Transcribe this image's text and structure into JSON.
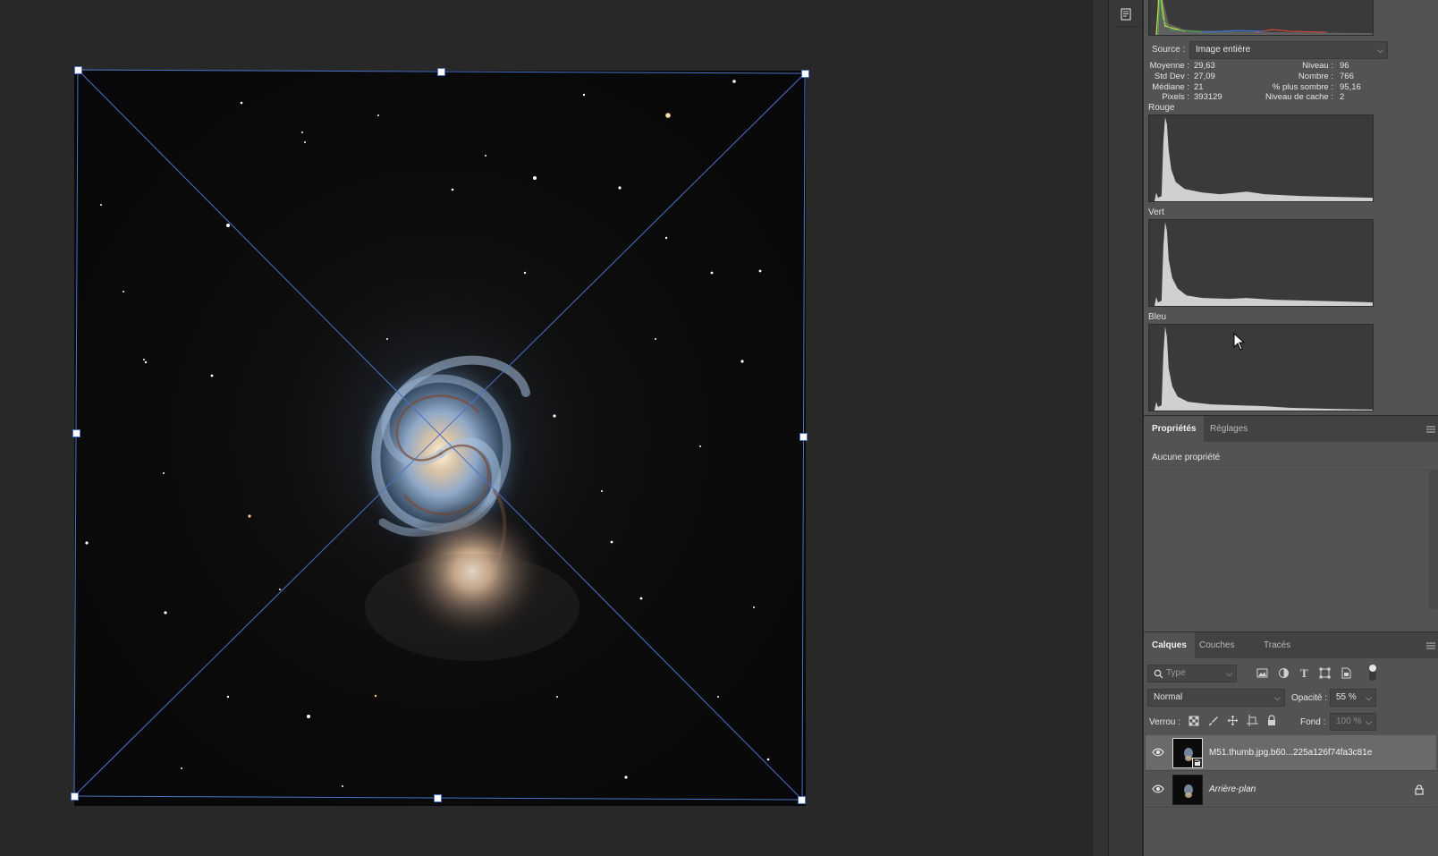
{
  "histogram": {
    "source_label": "Source :",
    "source_value": "Image entière",
    "stats_left": [
      {
        "label": "Moyenne :",
        "value": "29,63"
      },
      {
        "label": "Std Dev :",
        "value": "27,09"
      },
      {
        "label": "Médiane :",
        "value": "21"
      },
      {
        "label": "Pixels :",
        "value": "393129"
      }
    ],
    "stats_right": [
      {
        "label": "Niveau :",
        "value": "96"
      },
      {
        "label": "Nombre :",
        "value": "766"
      },
      {
        "label": "% plus sombre :",
        "value": "95,16"
      },
      {
        "label": "Niveau de cache :",
        "value": "2"
      }
    ],
    "channels": [
      "Rouge",
      "Vert",
      "Bleu"
    ]
  },
  "properties_panel": {
    "tabs": [
      "Propriétés",
      "Réglages"
    ],
    "active_tab": "Propriétés",
    "empty_text": "Aucune propriété"
  },
  "layers_panel": {
    "tabs": [
      "Calques",
      "Couches",
      "Tracés"
    ],
    "active_tab": "Calques",
    "filter_placeholder": "Type",
    "blend_mode": "Normal",
    "opacity_label": "Opacité :",
    "opacity_value": "55 %",
    "lock_label": "Verrou :",
    "fill_label": "Fond :",
    "fill_value": "100 %",
    "layers": [
      {
        "name": "M51.thumb.jpg.b60...225a126f74fa3c81e",
        "visible": true,
        "selected": true,
        "smart_object": true
      },
      {
        "name": "Arrière-plan",
        "visible": true,
        "selected": false,
        "locked": true
      }
    ]
  },
  "colors": {
    "accent": "#4a73c8",
    "panel_bg": "#535353",
    "canvas_bg": "#282828"
  }
}
